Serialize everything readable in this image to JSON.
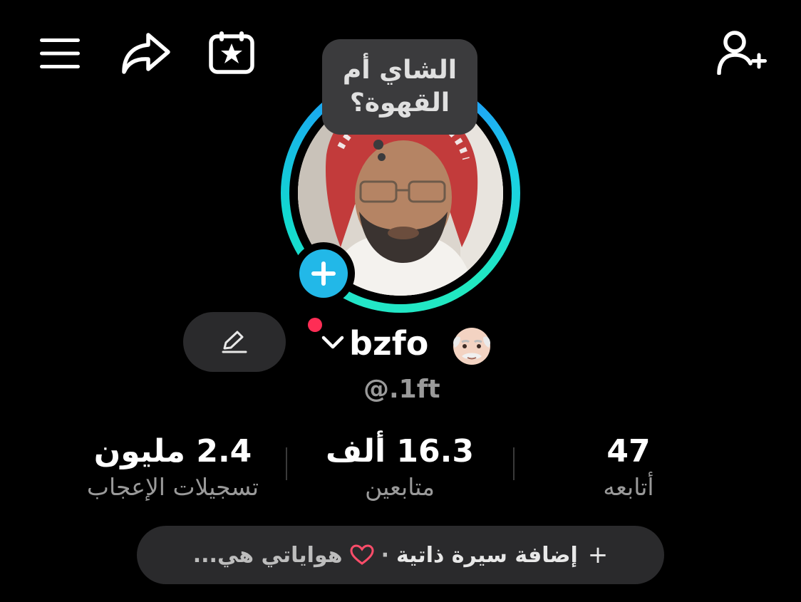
{
  "header": {
    "menu_icon": "hamburger-menu-icon",
    "share_icon": "share-arrow-icon",
    "events_icon": "calendar-star-icon",
    "add_friend_icon": "add-user-icon"
  },
  "profile": {
    "note_bubble": "الشاي أم\nالقهوة؟",
    "username": "bzfo",
    "handle": "@.1ft",
    "emoji_icon": "old-man-emoji-icon",
    "live_dot_color": "#ff2d55",
    "ring_colors": [
      "#23e6c8",
      "#2290ff"
    ],
    "add_story_color": "#22b8e8"
  },
  "stats": [
    {
      "value": "2.4 مليون",
      "label": "تسجيلات الإعجاب"
    },
    {
      "value": "16.3 ألف",
      "label": "متابعين"
    },
    {
      "value": "47",
      "label": "أتابعه"
    }
  ],
  "bio": {
    "add_label": "إضافة سيرة ذاتية",
    "separator": "·",
    "heart_icon": "heart-outline-icon",
    "preview": "هواياتي هي...",
    "plus": "+"
  }
}
